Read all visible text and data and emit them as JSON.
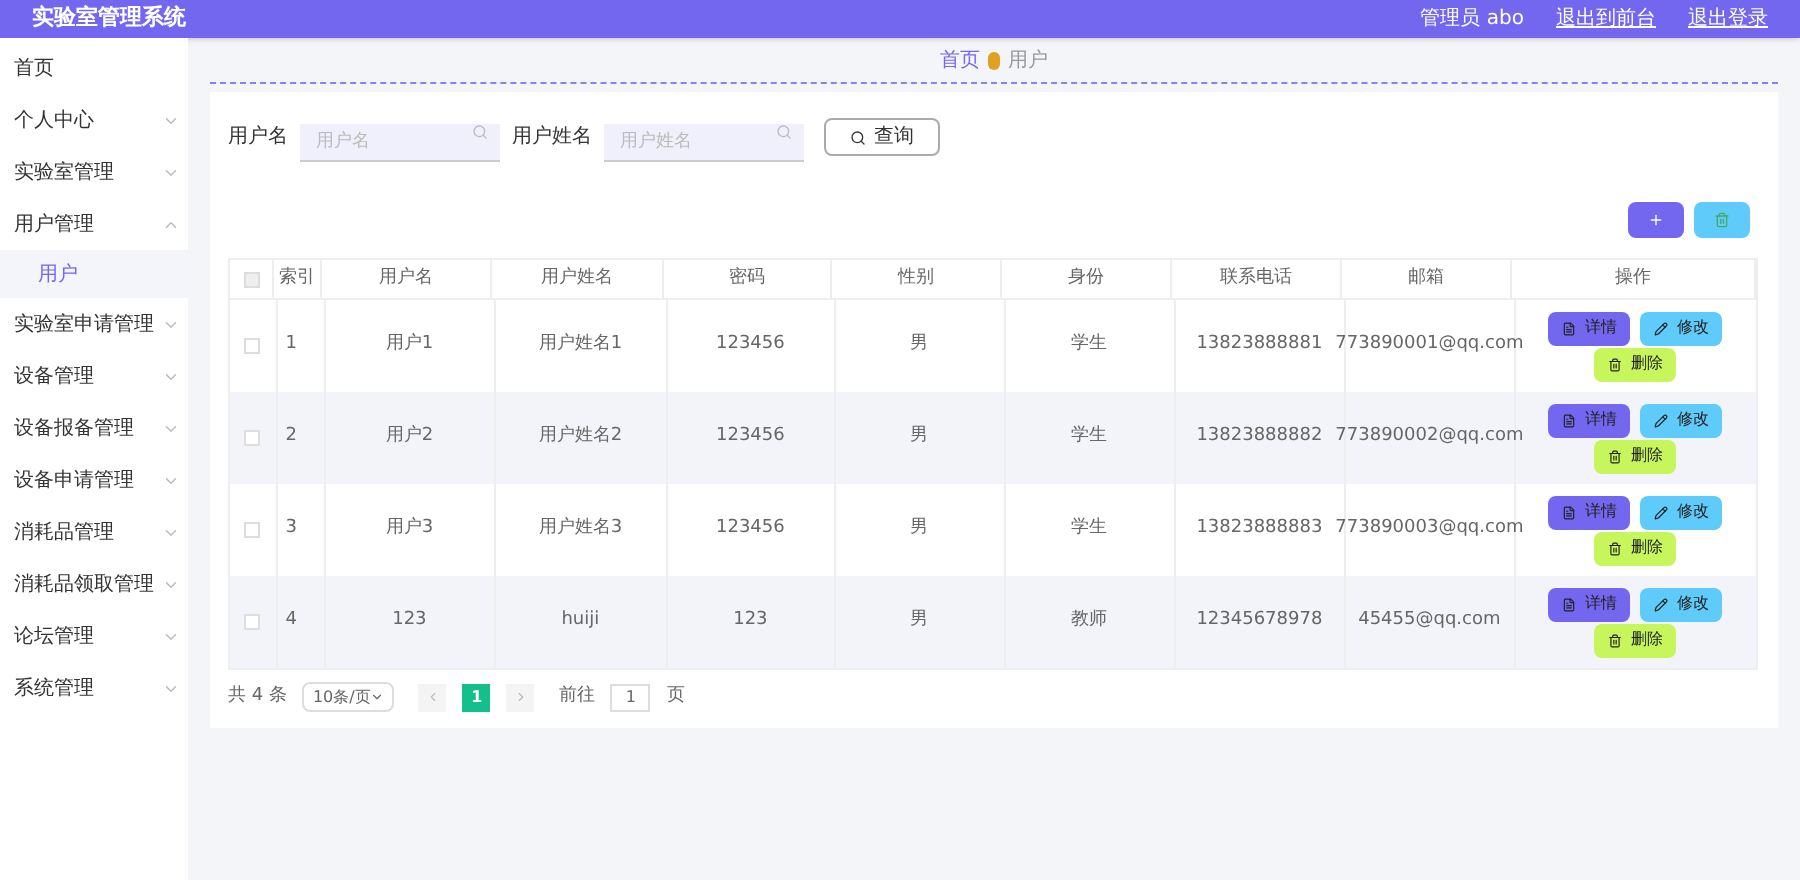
{
  "header": {
    "title": "实验室管理系统",
    "links": [
      "管理员 abo",
      "退出到前台",
      "退出登录"
    ]
  },
  "sidebar": {
    "items": [
      {
        "label": "首页"
      },
      {
        "label": "个人中心",
        "expanded": false
      },
      {
        "label": "实验室管理",
        "expanded": false
      },
      {
        "label": "用户管理",
        "expanded": true,
        "children": [
          {
            "label": "用户",
            "selected": true
          }
        ]
      },
      {
        "label": "实验室申请管理",
        "expanded": false
      },
      {
        "label": "设备管理",
        "expanded": false
      },
      {
        "label": "设备报备管理",
        "expanded": false
      },
      {
        "label": "设备申请管理",
        "expanded": false
      },
      {
        "label": "消耗品管理",
        "expanded": false
      },
      {
        "label": "消耗品领取管理",
        "expanded": false
      },
      {
        "label": "论坛管理",
        "expanded": false
      },
      {
        "label": "系统管理",
        "expanded": false
      }
    ]
  },
  "breadcrumb": [
    "首页",
    "用户"
  ],
  "search": {
    "fields": [
      {
        "label": "用户名",
        "placeholder": "用户名"
      },
      {
        "label": "用户姓名",
        "placeholder": "用户姓名"
      }
    ],
    "button": "查询"
  },
  "table": {
    "all_selected": false,
    "columns": [
      "索引",
      "用户名",
      "用户姓名",
      "密码",
      "性别",
      "身份",
      "联系电话",
      "邮箱",
      "操作"
    ],
    "rows": [
      {
        "selected": false,
        "cells": [
          "1",
          "用户1",
          "用户姓名1",
          "123456",
          "男",
          "学生",
          "13823888881",
          "773890001@qq.com"
        ],
        "actions": [
          "详情",
          "修改",
          "删除"
        ]
      },
      {
        "selected": false,
        "cells": [
          "2",
          "用户2",
          "用户姓名2",
          "123456",
          "男",
          "学生",
          "13823888882",
          "773890002@qq.com"
        ],
        "actions": [
          "详情",
          "修改",
          "删除"
        ]
      },
      {
        "selected": false,
        "cells": [
          "3",
          "用户3",
          "用户姓名3",
          "123456",
          "男",
          "学生",
          "13823888883",
          "773890003@qq.com"
        ],
        "actions": [
          "详情",
          "修改",
          "删除"
        ]
      },
      {
        "selected": false,
        "cells": [
          "4",
          "123",
          "huiji",
          "123",
          "男",
          "教师",
          "12345678978",
          "45455@qq.com"
        ],
        "actions": [
          "详情",
          "修改",
          "删除"
        ]
      }
    ]
  },
  "pagination": {
    "total": "共 4 条",
    "page_size": "10条/页",
    "pages": [
      {
        "label": "1",
        "selected": true
      }
    ],
    "goto_label": "前往",
    "goto_value": "1",
    "goto_suffix": "页"
  }
}
